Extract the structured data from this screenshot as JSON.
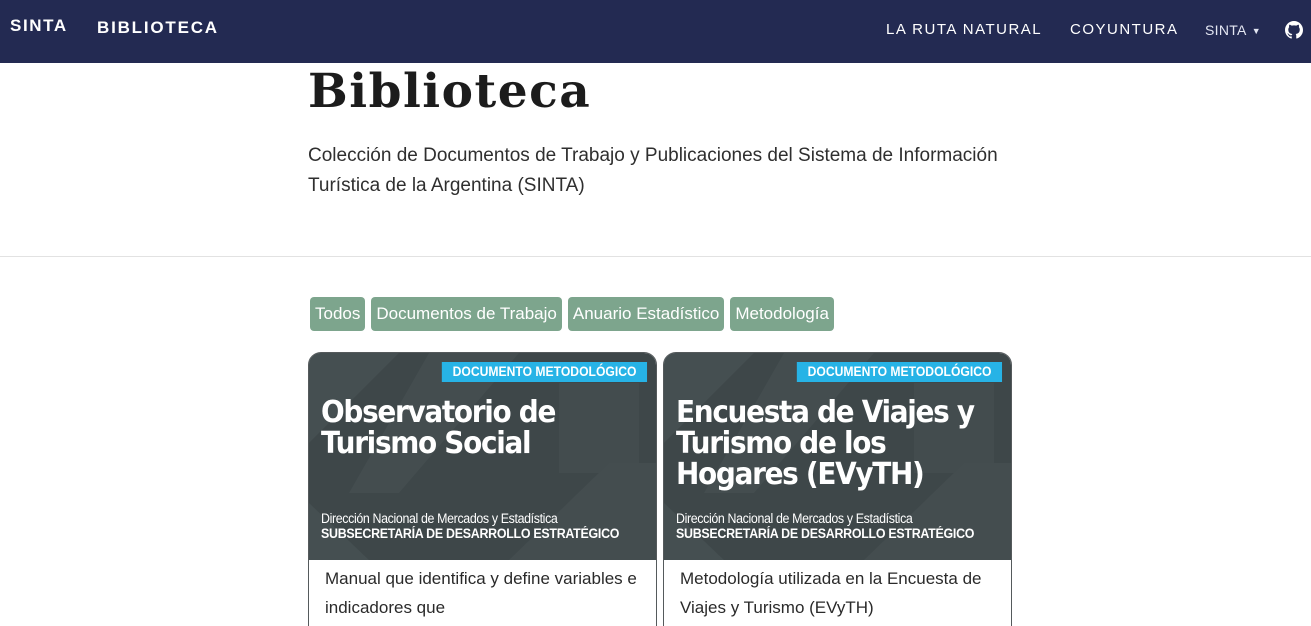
{
  "navbar": {
    "brand": "SINTA",
    "site_title": "BIBLIOTECA",
    "links": [
      "LA RUTA NATURAL",
      "COYUNTURA"
    ],
    "dropdown_label": "SINTA",
    "dropdown_caret": "▼",
    "github_icon": "github-icon"
  },
  "header": {
    "title": "Biblioteca",
    "description": "Colección de Documentos de Trabajo y Publicaciones del Sistema de Información Turística de la Argentina (SINTA)"
  },
  "filters": [
    "Todos",
    "Documentos de Trabajo",
    "Anuario Estadístico",
    "Metodología"
  ],
  "cards": [
    {
      "tag": "DOCUMENTO METODOLÓGICO",
      "title": "Observatorio de Turismo Social",
      "org": "Dirección Nacional de Mercados y Estadística",
      "suborg": "SUBSECRETARÍA DE DESARROLLO ESTRATÉGICO",
      "description": "Manual que identifica y define variables e indicadores que"
    },
    {
      "tag": "DOCUMENTO METODOLÓGICO",
      "title": "Encuesta de Viajes y Turismo de los Hogares (EVyTH)",
      "org": "Dirección Nacional de Mercados y Estadística",
      "suborg": "SUBSECRETARÍA DE DESARROLLO ESTRATÉGICO",
      "description": "Metodología utilizada en la Encuesta de Viajes y Turismo (EVyTH)"
    }
  ],
  "colors": {
    "navbar_bg": "#232a52",
    "filter_bg": "#7da58d",
    "cover_bg": "#3e4749",
    "tag_bg": "#27b3e6"
  }
}
